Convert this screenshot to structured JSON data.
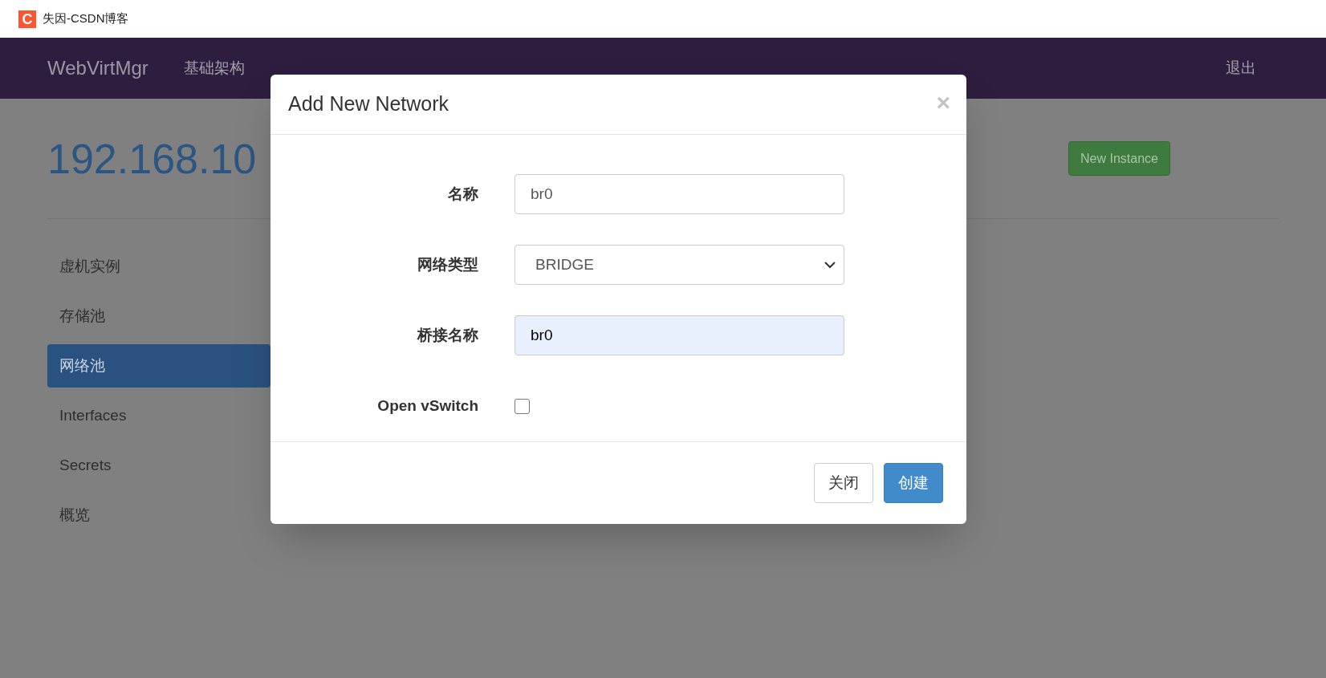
{
  "header": {
    "logo_text": "C",
    "title": "失因-CSDN博客"
  },
  "navbar": {
    "brand": "WebVirtMgr",
    "links": [
      {
        "label": "基础架构"
      }
    ],
    "logout": "退出"
  },
  "page": {
    "heading": "192.168.10",
    "new_instance_button": "New Instance"
  },
  "sidebar": {
    "items": [
      {
        "label": "虚机实例",
        "selected": false
      },
      {
        "label": "存储池",
        "selected": false
      },
      {
        "label": "网络池",
        "selected": true
      },
      {
        "label": "Interfaces",
        "selected": false
      },
      {
        "label": "Secrets",
        "selected": false
      },
      {
        "label": "概览",
        "selected": false
      }
    ]
  },
  "modal": {
    "title": "Add New Network",
    "close": "×",
    "fields": [
      {
        "kind": "text",
        "label": "名称",
        "value": "br0",
        "autofilled": false
      },
      {
        "kind": "select",
        "label": "网络类型",
        "value": "BRIDGE"
      },
      {
        "kind": "text",
        "label": "桥接名称",
        "value": "br0",
        "autofilled": true
      },
      {
        "kind": "checkbox",
        "label": "Open vSwitch",
        "checked": false
      }
    ],
    "buttons": [
      {
        "label": "关闭",
        "kind": "default"
      },
      {
        "label": "创建",
        "kind": "primary"
      }
    ]
  }
}
